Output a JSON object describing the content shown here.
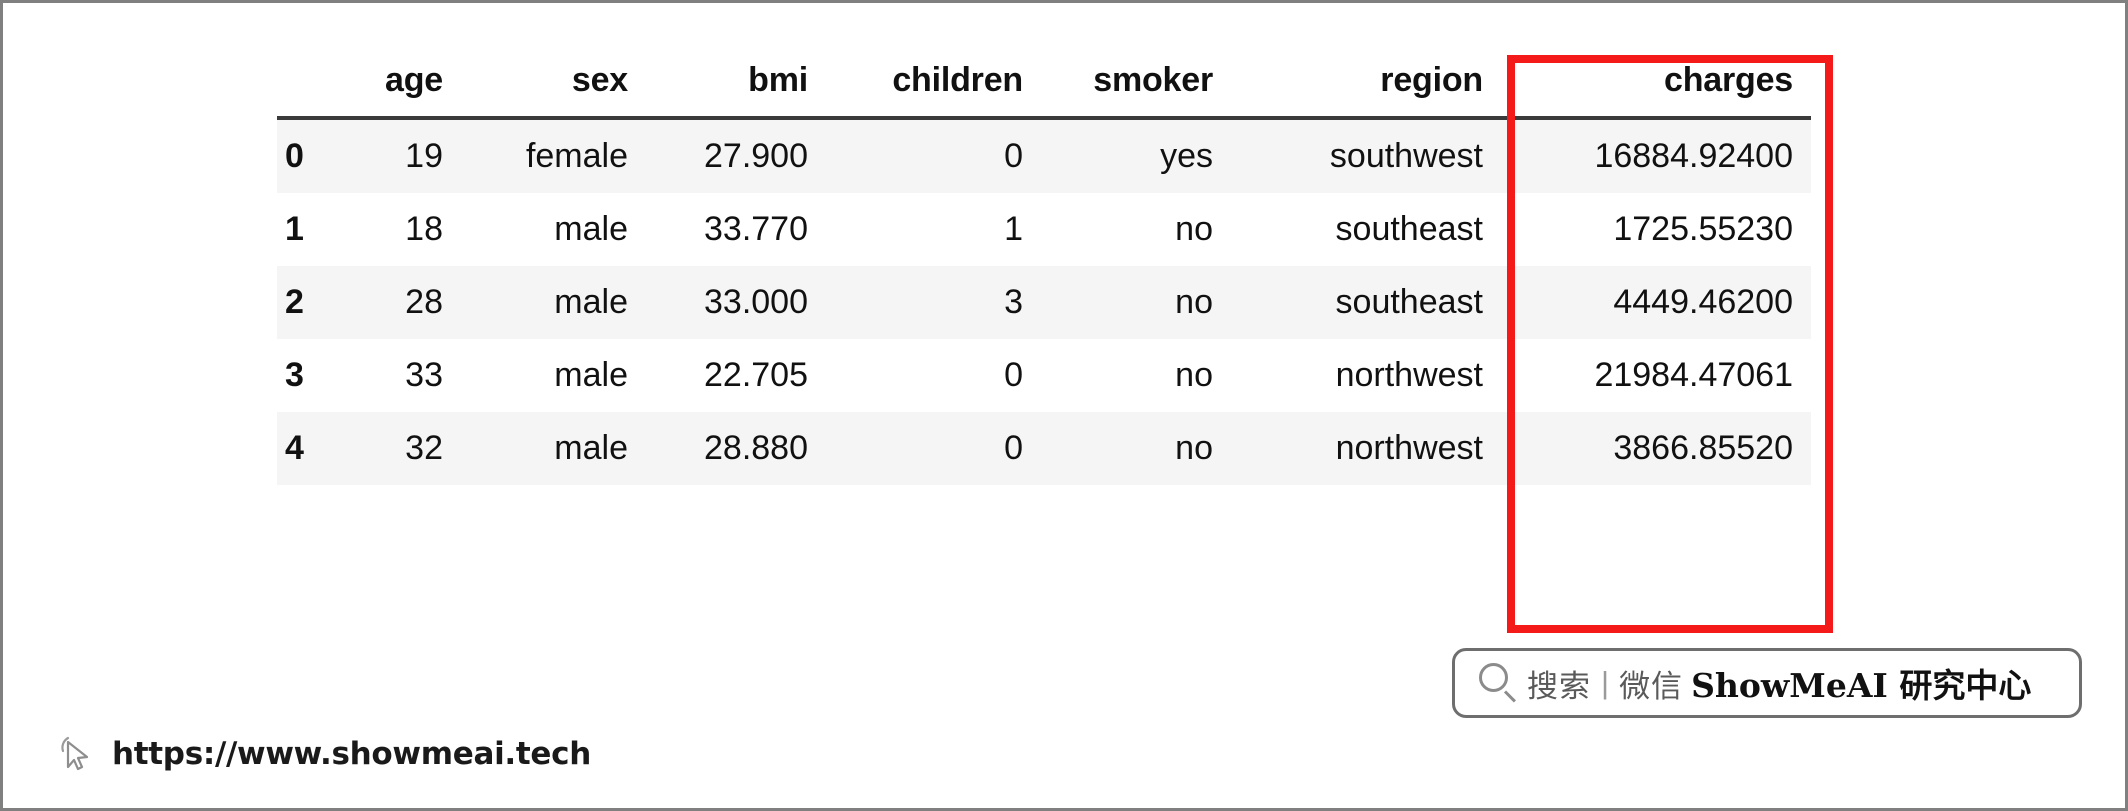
{
  "table": {
    "index_header": "",
    "columns": [
      "age",
      "sex",
      "bmi",
      "children",
      "smoker",
      "region",
      "charges"
    ],
    "rows": [
      {
        "index": "0",
        "age": "19",
        "sex": "female",
        "bmi": "27.900",
        "children": "0",
        "smoker": "yes",
        "region": "southwest",
        "charges": "16884.92400"
      },
      {
        "index": "1",
        "age": "18",
        "sex": "male",
        "bmi": "33.770",
        "children": "1",
        "smoker": "no",
        "region": "southeast",
        "charges": "1725.55230"
      },
      {
        "index": "2",
        "age": "28",
        "sex": "male",
        "bmi": "33.000",
        "children": "3",
        "smoker": "no",
        "region": "southeast",
        "charges": "4449.46200"
      },
      {
        "index": "3",
        "age": "33",
        "sex": "male",
        "bmi": "22.705",
        "children": "0",
        "smoker": "no",
        "region": "northwest",
        "charges": "21984.47061"
      },
      {
        "index": "4",
        "age": "32",
        "sex": "male",
        "bmi": "28.880",
        "children": "0",
        "smoker": "no",
        "region": "northwest",
        "charges": "3866.85520"
      }
    ]
  },
  "highlight": {
    "target_column": "charges",
    "color": "#f51a1a"
  },
  "watermark": {
    "search_label": "搜索",
    "separator": "|",
    "channel_label": "微信",
    "brand": "ShowMeAI 研究中心",
    "icon": "search-icon"
  },
  "footer": {
    "url": "https://www.showmeai.tech",
    "icon": "cursor-pointer-icon"
  }
}
